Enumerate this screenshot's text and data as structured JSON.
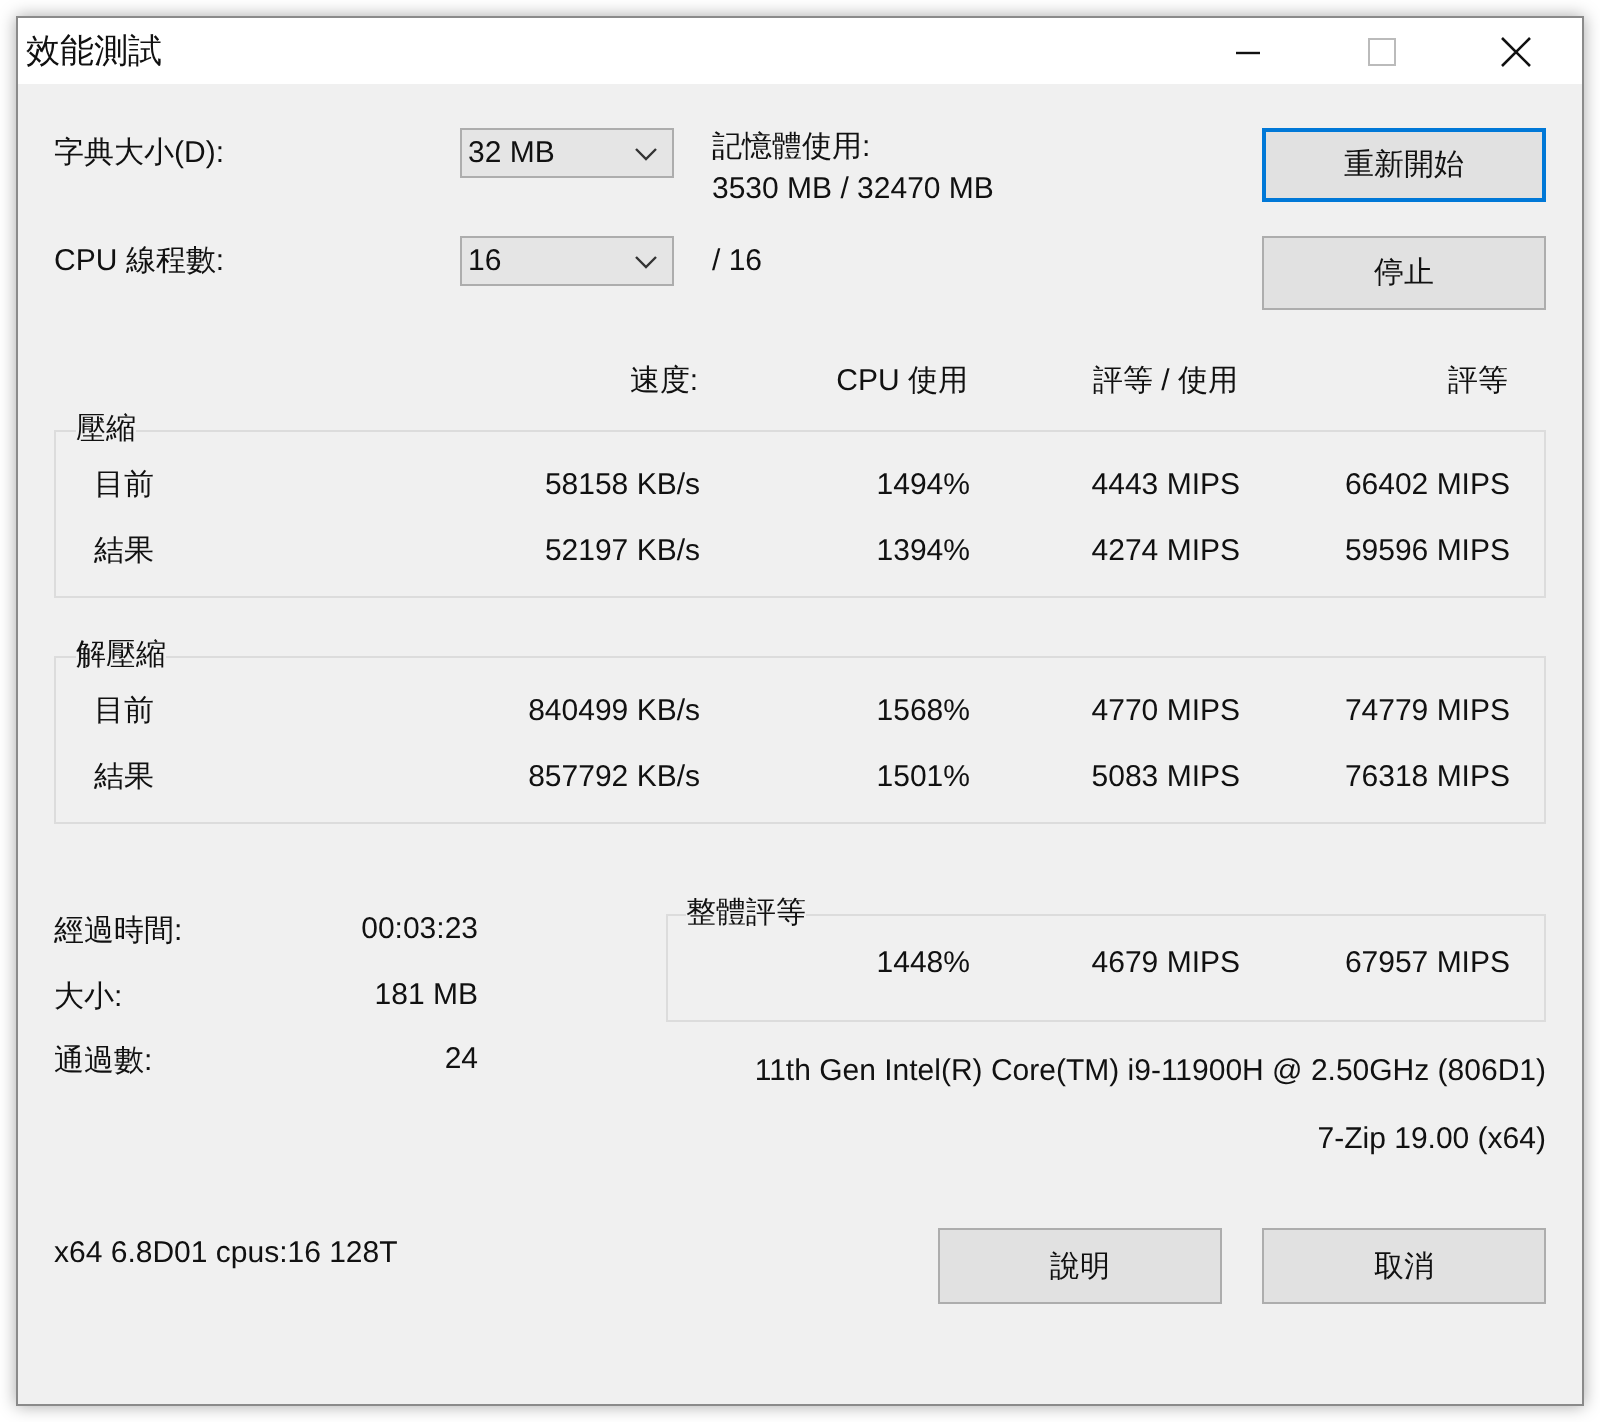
{
  "window": {
    "title": "效能測試"
  },
  "settings": [
    {
      "label": "字典大小(D):",
      "value": "32 MB"
    },
    {
      "label": "CPU 線程數:",
      "value": "16",
      "suffix": "/ 16"
    }
  ],
  "memory": {
    "label": "記憶體使用:",
    "value": "3530 MB / 32470 MB"
  },
  "actions": [
    {
      "label": "重新開始",
      "focused": true
    },
    {
      "label": "停止",
      "focused": false
    }
  ],
  "columns": [
    "速度:",
    "CPU 使用",
    "評等 / 使用",
    "評等"
  ],
  "groups": [
    {
      "title": "壓縮",
      "rows": [
        {
          "label": "目前",
          "values": [
            "58158 KB/s",
            "1494%",
            "4443 MIPS",
            "66402 MIPS"
          ]
        },
        {
          "label": "結果",
          "values": [
            "52197 KB/s",
            "1394%",
            "4274 MIPS",
            "59596 MIPS"
          ]
        }
      ]
    },
    {
      "title": "解壓縮",
      "rows": [
        {
          "label": "目前",
          "values": [
            "840499 KB/s",
            "1568%",
            "4770 MIPS",
            "74779 MIPS"
          ]
        },
        {
          "label": "結果",
          "values": [
            "857792 KB/s",
            "1501%",
            "5083 MIPS",
            "76318 MIPS"
          ]
        }
      ]
    }
  ],
  "stats": [
    {
      "label": "經過時間:",
      "value": "00:03:23"
    },
    {
      "label": "大小:",
      "value": "181 MB"
    },
    {
      "label": "通過數:",
      "value": "24"
    }
  ],
  "overall": {
    "title": "整體評等",
    "values": [
      "1448%",
      "4679 MIPS",
      "67957 MIPS"
    ]
  },
  "cpu_info": "11th Gen Intel(R) Core(TM) i9-11900H @ 2.50GHz (806D1)",
  "version": "7-Zip 19.00 (x64)",
  "build_info": "x64 6.8D01 cpus:16 128T",
  "buttons": [
    "說明",
    "取消"
  ]
}
